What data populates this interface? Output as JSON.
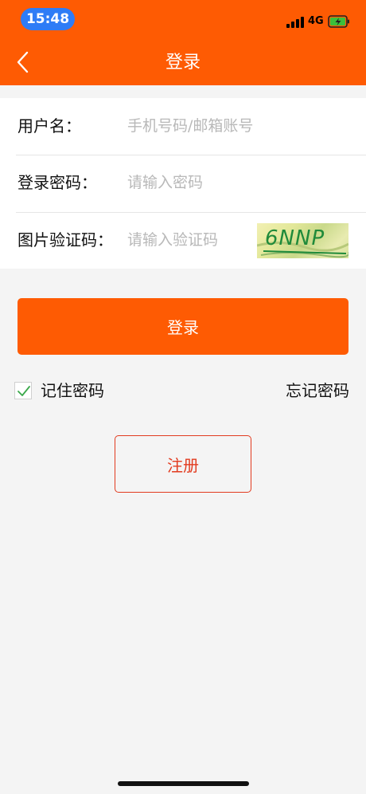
{
  "status_bar": {
    "time": "15:48",
    "network": "4G",
    "battery_color": "#3bbf3b",
    "icons": [
      "signal-icon",
      "battery-charging-icon"
    ]
  },
  "nav": {
    "title": "登录",
    "back_icon": "chevron-left-icon"
  },
  "form": {
    "username": {
      "label": "用户名：",
      "placeholder": "手机号码/邮箱账号",
      "value": ""
    },
    "password": {
      "label": "登录密码：",
      "placeholder": "请输入密码",
      "value": ""
    },
    "captcha": {
      "label": "图片验证码：",
      "placeholder": "请输入验证码",
      "value": "",
      "image_text": "6NNP"
    }
  },
  "login_button": {
    "label": "登录"
  },
  "remember": {
    "label": "记住密码",
    "checked": true,
    "check_icon": "checkmark-icon"
  },
  "forgot": {
    "label": "忘记密码"
  },
  "register_button": {
    "label": "注册"
  },
  "colors": {
    "accent": "#fe5b03",
    "register_red": "#e23b1f",
    "background": "#f4f4f4",
    "time_pill": "#2e7cf6"
  }
}
